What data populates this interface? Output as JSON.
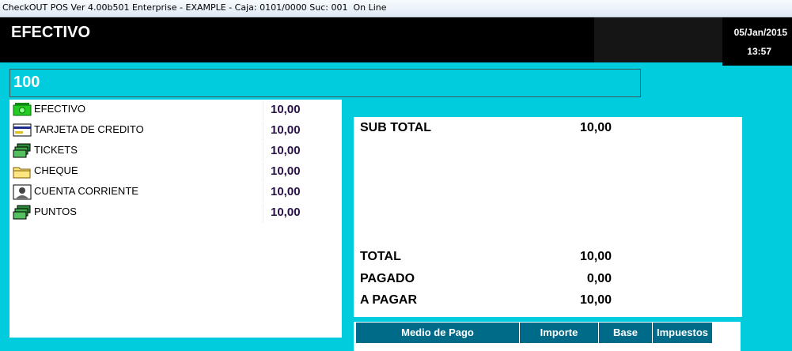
{
  "window": {
    "title": "CheckOUT POS Ver 4.00b501 Enterprise - EXAMPLE - Caja: 0101/0000 Suc: 001  On Line"
  },
  "header": {
    "title": "EFECTIVO",
    "date": "05/Jan/2015",
    "time": "13:57"
  },
  "amount": {
    "value": "100"
  },
  "payment_methods": [
    {
      "label": "EFECTIVO",
      "value": "10,00",
      "icon": "cash-icon"
    },
    {
      "label": "TARJETA DE CREDITO",
      "value": "10,00",
      "icon": "credit-card-icon"
    },
    {
      "label": "TICKETS",
      "value": "10,00",
      "icon": "tickets-icon"
    },
    {
      "label": "CHEQUE",
      "value": "10,00",
      "icon": "cheque-icon"
    },
    {
      "label": "CUENTA CORRIENTE",
      "value": "10,00",
      "icon": "account-icon"
    },
    {
      "label": "PUNTOS",
      "value": "10,00",
      "icon": "points-icon"
    }
  ],
  "summary": {
    "subtotal_label": "SUB TOTAL",
    "subtotal_value": "10,00",
    "total_label": "TOTAL",
    "total_value": "10,00",
    "pagado_label": "PAGADO",
    "pagado_value": "0,00",
    "apagar_label": "A PAGAR",
    "apagar_value": "10,00"
  },
  "grid": {
    "headers": [
      "Medio de Pago",
      "Importe",
      "Base",
      "Impuestos"
    ]
  },
  "colors": {
    "background": "#00ccdd",
    "header": "#000000",
    "grid_header": "#006b89",
    "value_text": "#2a1048"
  }
}
